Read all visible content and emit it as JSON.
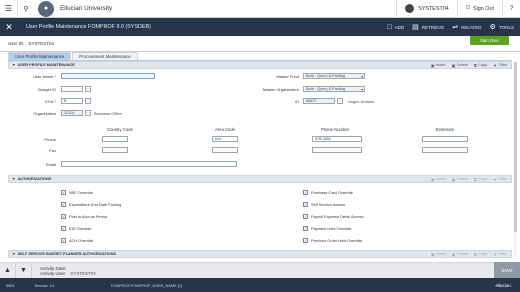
{
  "topbar": {
    "institution": "Ellucian University",
    "user": "SYSTEST04",
    "signout": "Sign Out",
    "help": "?"
  },
  "titlebar": {
    "title": "User Profile Maintenance FOMPROF 9.0 (SYSDEB)",
    "actions": [
      {
        "icon": "document-icon",
        "label": "ADD"
      },
      {
        "icon": "retrieve-icon",
        "label": "RETRIEVE"
      },
      {
        "icon": "related-icon",
        "label": "RELATED"
      },
      {
        "icon": "gear-icon",
        "label": "TOOLS"
      }
    ]
  },
  "keyblock": {
    "label": "User ID:",
    "value": "SYSTEST04",
    "start_over": "Start Over"
  },
  "tabs": [
    {
      "label": "User Profile Maintenance",
      "active": true
    },
    {
      "label": "Procurement Maintenance",
      "active": false
    }
  ],
  "section_tools": {
    "insert": "Insert",
    "delete": "Delete",
    "copy": "Copy",
    "filter": "Filter"
  },
  "profile": {
    "header": "USER PROFILE MAINTENANCE",
    "user_name_label": "User Name *",
    "user_name_value": "",
    "budget_id_label": "Budget ID",
    "budget_id_value": "",
    "coa_label": "COA *",
    "coa_value": "B",
    "organization_label": "Organization",
    "organization_value": "12101",
    "organization_desc": "Business Office",
    "master_fund_label": "Master Fund",
    "master_fund_value": "Both - Query & Posting",
    "master_org_label": "Master Organization",
    "master_org_value": "Both - Query & Posting",
    "id_label": "ID",
    "id_value": "ANDY",
    "id_name": "Unger, Andrew",
    "col_country": "Country Code",
    "col_area": "Area Code",
    "col_phone": "Phone Number",
    "col_ext": "Extension",
    "phone_label": "Phone",
    "phone_area": "610",
    "phone_number": "578-3552",
    "fax_label": "Fax",
    "email_label": "Email"
  },
  "authorizations": {
    "header": "AUTHORIZATIONS",
    "left": [
      "NSF Override",
      "Expenditure End Date Posting",
      "Post in Accrual Period",
      "EDI Override",
      "ACH Override"
    ],
    "right": [
      "Purchase Card Override",
      "Self Service Access",
      "Payroll Expense Detail Access",
      "Payment Hold Override",
      "Previous Order Hold Override"
    ]
  },
  "budget_section": {
    "header": "SELF SERVICE BUDGET PLANNER AUTHORIZATIONS"
  },
  "bottom": {
    "activity_label": "Activity Date:",
    "activity_user_label": "Activity User:",
    "activity_user": "SYSTEST04",
    "save": "SAVE"
  },
  "status": {
    "code": "0001",
    "record": "Record: 1/1",
    "path": "FOMPROF.FOMPROF_USER_NAME [1]",
    "brand": "ellucian."
  },
  "colors": {
    "navy": "#26354a",
    "start_over": "#5ba21d",
    "active_tab": "#b4cde7"
  }
}
